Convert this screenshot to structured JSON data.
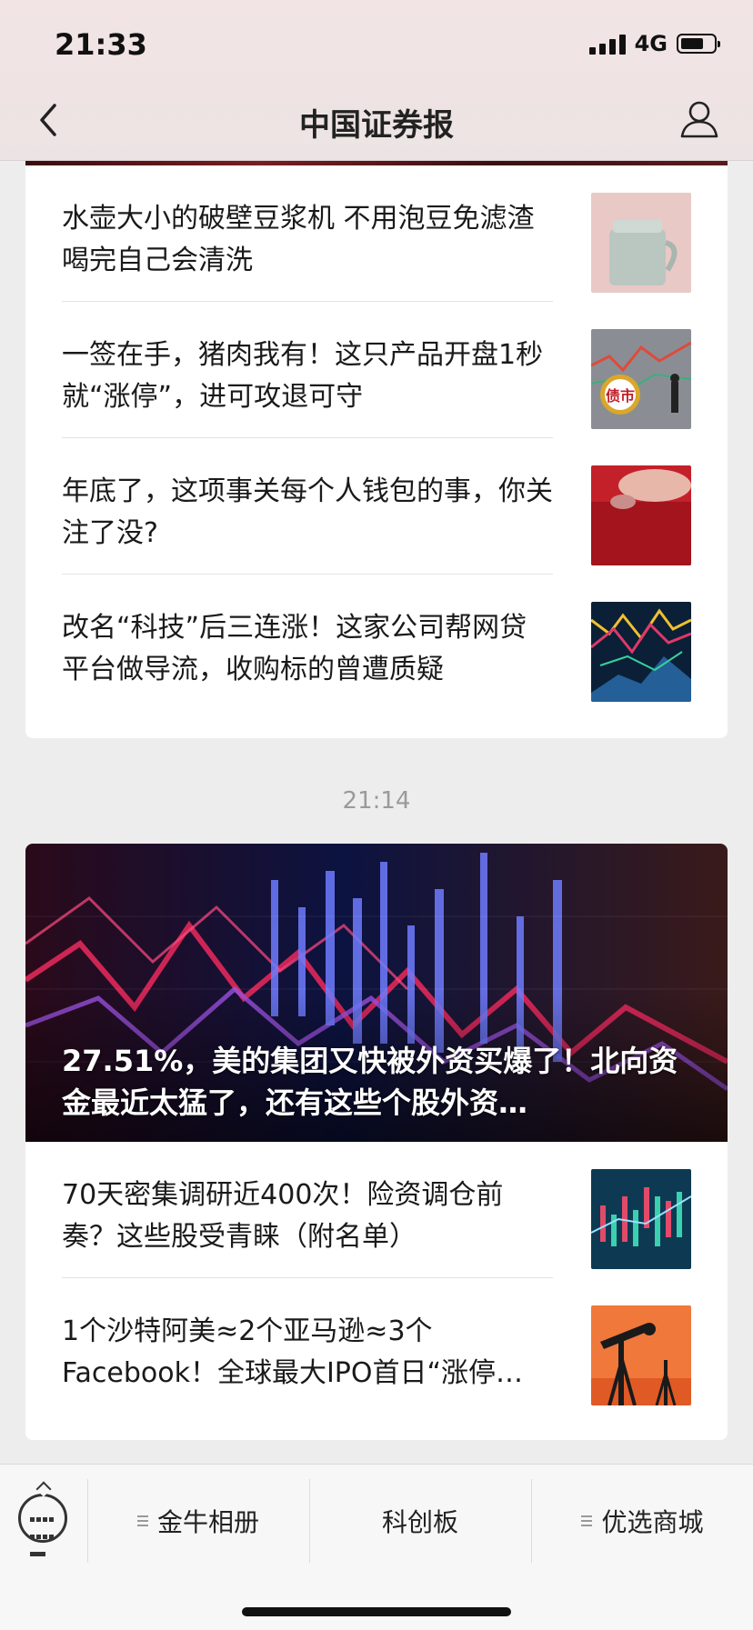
{
  "status_bar": {
    "time": "21:33",
    "network": "4G",
    "battery_level": 0.6
  },
  "header": {
    "title": "中国证券报",
    "back_icon": "chevron-left-icon",
    "profile_icon": "user-icon"
  },
  "feed": {
    "card1": {
      "items": [
        {
          "title": "水壶大小的破壁豆浆机 不用泡豆免滤渣 喝完自己会清洗",
          "thumb": "soymilk-maker"
        },
        {
          "title": "一签在手，猪肉我有！这只产品开盘1秒就“涨停”，进可攻退可守",
          "thumb": "bond-market",
          "thumb_label": "债市"
        },
        {
          "title": "年底了，这项事关每个人钱包的事，你关注了没?",
          "thumb": "red-wallet"
        },
        {
          "title": "改名“科技”后三连涨！这家公司帮网贷平台做导流，收购标的曾遭质疑",
          "thumb": "stock-chart"
        }
      ]
    },
    "timestamp": "21:14",
    "card2": {
      "hero_title": "27.51%，美的集团又快被外资买爆了！北向资金最近太猛了，还有这些个股外资…",
      "items": [
        {
          "title": "70天密集调研近400次！险资调仓前奏？这些股受青睐（附名单）",
          "thumb": "candlestick-chart"
        },
        {
          "title": "1个沙特阿美≈2个亚马逊≈3个Facebook！全球最大IPO首日“涨停…",
          "thumb": "oil-pump"
        }
      ]
    }
  },
  "bottom_bar": {
    "keyboard_icon": "keyboard-icon",
    "menus": [
      {
        "label": "金牛相册",
        "has_submenu": true
      },
      {
        "label": "科创板",
        "has_submenu": false
      },
      {
        "label": "优选商城",
        "has_submenu": true
      }
    ]
  }
}
